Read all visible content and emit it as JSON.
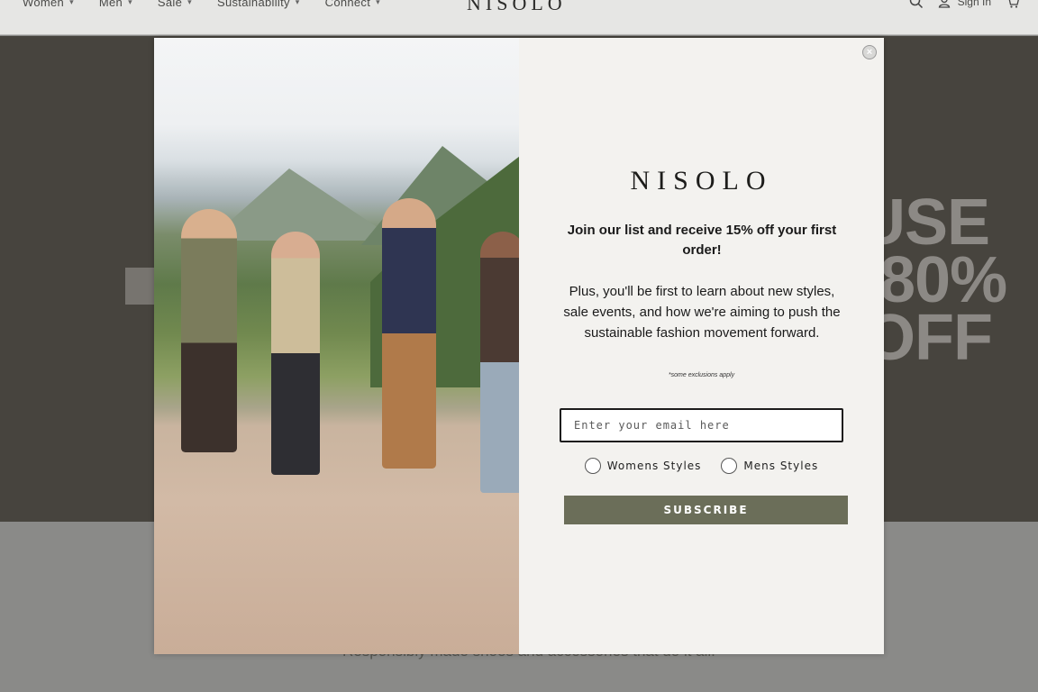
{
  "nav": {
    "items": [
      {
        "label": "Women"
      },
      {
        "label": "Men"
      },
      {
        "label": "Sale"
      },
      {
        "label": "Sustainability"
      },
      {
        "label": "Connect"
      }
    ],
    "brand": "NISOLO",
    "sign_in": "Sign In",
    "icons": [
      "search-icon",
      "account-icon",
      "cart-icon"
    ]
  },
  "hero": {
    "promo_line1": "USE",
    "promo_line2": "80%",
    "promo_line3": "OFF"
  },
  "lower": {
    "tagline": "Responsibly made shoes and accessories that do it all."
  },
  "modal": {
    "logo": "NISOLO",
    "heading": "Join our list and receive 15% off your first order!",
    "body": "Plus, you'll be first to learn about new styles, sale events, and how we're aiming to push the sustainable fashion movement forward.",
    "fine_print": "*some exclusions apply",
    "email_placeholder": "Enter your email here",
    "options": [
      "Womens Styles",
      "Mens Styles"
    ],
    "subscribe_label": "SUBSCRIBE"
  },
  "colors": {
    "hero_bg": "#47443e",
    "subscribe_bg": "#6b6e59",
    "form_bg": "#f3f2ef"
  }
}
